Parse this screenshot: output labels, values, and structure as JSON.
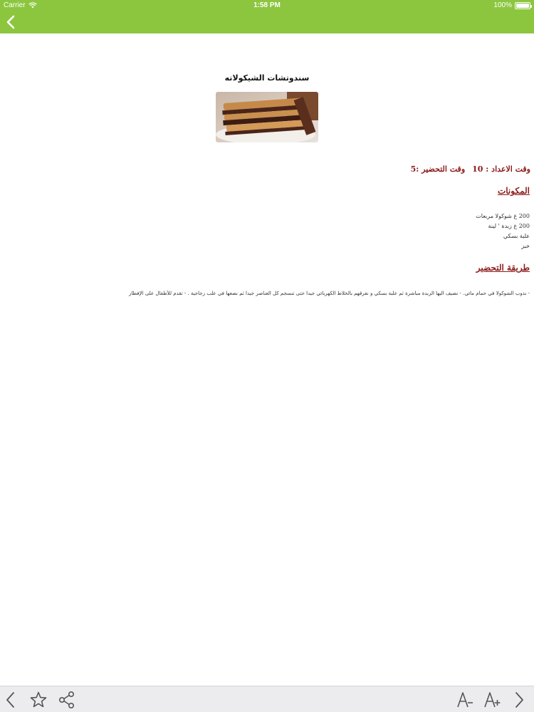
{
  "status_bar": {
    "carrier": "Carrier",
    "time": "1:58 PM",
    "battery": "100%"
  },
  "nav": {
    "back_icon": "chevron-left-icon"
  },
  "recipe": {
    "title": "سندوتشات الشيكولاته",
    "prep_time": "وقت الاعداد : 10",
    "cook_time": "وقت التحضير :5",
    "ingredients_heading": "المكونات",
    "ingredients": [
      "200 غ شوكولا مربعات",
      "200 غ زبدة ' لينة",
      "علبة بسكي",
      "خبز"
    ],
    "method_heading": "طريقة التحضير",
    "method": "- نذوب الشوكولا في حمام مائي. - نضيف اليها الزبدة مباشرة ثم علبة بسكي و نفرقهم بالخلاط الكهربائي جيدا حتى تنسجم كل العناصر جيدا ثم نضعها في علب زجاجية . - تقدم للأطفال على الإفطار"
  },
  "toolbar": {
    "icons": [
      "chevron-left-icon",
      "star-icon",
      "share-icon",
      "font-decrease-icon",
      "font-increase-icon",
      "chevron-right-icon"
    ]
  },
  "colors": {
    "nav_green": "#8cc63f",
    "heading_red": "#8b1a1a",
    "toolbar_bg": "#ececef",
    "icon_gray": "#555555"
  }
}
